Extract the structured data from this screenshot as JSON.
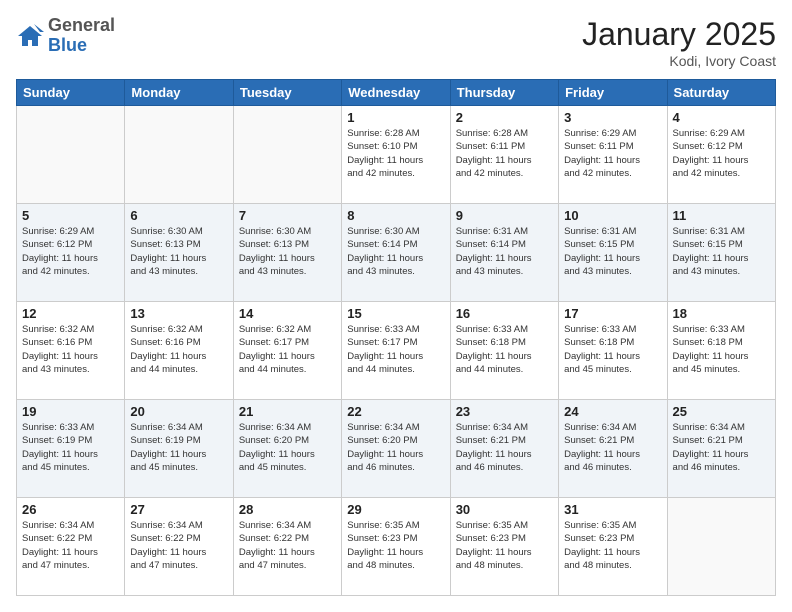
{
  "header": {
    "logo_general": "General",
    "logo_blue": "Blue",
    "month": "January 2025",
    "location": "Kodi, Ivory Coast"
  },
  "days_of_week": [
    "Sunday",
    "Monday",
    "Tuesday",
    "Wednesday",
    "Thursday",
    "Friday",
    "Saturday"
  ],
  "weeks": [
    [
      {
        "day": "",
        "info": ""
      },
      {
        "day": "",
        "info": ""
      },
      {
        "day": "",
        "info": ""
      },
      {
        "day": "1",
        "info": "Sunrise: 6:28 AM\nSunset: 6:10 PM\nDaylight: 11 hours\nand 42 minutes."
      },
      {
        "day": "2",
        "info": "Sunrise: 6:28 AM\nSunset: 6:11 PM\nDaylight: 11 hours\nand 42 minutes."
      },
      {
        "day": "3",
        "info": "Sunrise: 6:29 AM\nSunset: 6:11 PM\nDaylight: 11 hours\nand 42 minutes."
      },
      {
        "day": "4",
        "info": "Sunrise: 6:29 AM\nSunset: 6:12 PM\nDaylight: 11 hours\nand 42 minutes."
      }
    ],
    [
      {
        "day": "5",
        "info": "Sunrise: 6:29 AM\nSunset: 6:12 PM\nDaylight: 11 hours\nand 42 minutes."
      },
      {
        "day": "6",
        "info": "Sunrise: 6:30 AM\nSunset: 6:13 PM\nDaylight: 11 hours\nand 43 minutes."
      },
      {
        "day": "7",
        "info": "Sunrise: 6:30 AM\nSunset: 6:13 PM\nDaylight: 11 hours\nand 43 minutes."
      },
      {
        "day": "8",
        "info": "Sunrise: 6:30 AM\nSunset: 6:14 PM\nDaylight: 11 hours\nand 43 minutes."
      },
      {
        "day": "9",
        "info": "Sunrise: 6:31 AM\nSunset: 6:14 PM\nDaylight: 11 hours\nand 43 minutes."
      },
      {
        "day": "10",
        "info": "Sunrise: 6:31 AM\nSunset: 6:15 PM\nDaylight: 11 hours\nand 43 minutes."
      },
      {
        "day": "11",
        "info": "Sunrise: 6:31 AM\nSunset: 6:15 PM\nDaylight: 11 hours\nand 43 minutes."
      }
    ],
    [
      {
        "day": "12",
        "info": "Sunrise: 6:32 AM\nSunset: 6:16 PM\nDaylight: 11 hours\nand 43 minutes."
      },
      {
        "day": "13",
        "info": "Sunrise: 6:32 AM\nSunset: 6:16 PM\nDaylight: 11 hours\nand 44 minutes."
      },
      {
        "day": "14",
        "info": "Sunrise: 6:32 AM\nSunset: 6:17 PM\nDaylight: 11 hours\nand 44 minutes."
      },
      {
        "day": "15",
        "info": "Sunrise: 6:33 AM\nSunset: 6:17 PM\nDaylight: 11 hours\nand 44 minutes."
      },
      {
        "day": "16",
        "info": "Sunrise: 6:33 AM\nSunset: 6:18 PM\nDaylight: 11 hours\nand 44 minutes."
      },
      {
        "day": "17",
        "info": "Sunrise: 6:33 AM\nSunset: 6:18 PM\nDaylight: 11 hours\nand 45 minutes."
      },
      {
        "day": "18",
        "info": "Sunrise: 6:33 AM\nSunset: 6:18 PM\nDaylight: 11 hours\nand 45 minutes."
      }
    ],
    [
      {
        "day": "19",
        "info": "Sunrise: 6:33 AM\nSunset: 6:19 PM\nDaylight: 11 hours\nand 45 minutes."
      },
      {
        "day": "20",
        "info": "Sunrise: 6:34 AM\nSunset: 6:19 PM\nDaylight: 11 hours\nand 45 minutes."
      },
      {
        "day": "21",
        "info": "Sunrise: 6:34 AM\nSunset: 6:20 PM\nDaylight: 11 hours\nand 45 minutes."
      },
      {
        "day": "22",
        "info": "Sunrise: 6:34 AM\nSunset: 6:20 PM\nDaylight: 11 hours\nand 46 minutes."
      },
      {
        "day": "23",
        "info": "Sunrise: 6:34 AM\nSunset: 6:21 PM\nDaylight: 11 hours\nand 46 minutes."
      },
      {
        "day": "24",
        "info": "Sunrise: 6:34 AM\nSunset: 6:21 PM\nDaylight: 11 hours\nand 46 minutes."
      },
      {
        "day": "25",
        "info": "Sunrise: 6:34 AM\nSunset: 6:21 PM\nDaylight: 11 hours\nand 46 minutes."
      }
    ],
    [
      {
        "day": "26",
        "info": "Sunrise: 6:34 AM\nSunset: 6:22 PM\nDaylight: 11 hours\nand 47 minutes."
      },
      {
        "day": "27",
        "info": "Sunrise: 6:34 AM\nSunset: 6:22 PM\nDaylight: 11 hours\nand 47 minutes."
      },
      {
        "day": "28",
        "info": "Sunrise: 6:34 AM\nSunset: 6:22 PM\nDaylight: 11 hours\nand 47 minutes."
      },
      {
        "day": "29",
        "info": "Sunrise: 6:35 AM\nSunset: 6:23 PM\nDaylight: 11 hours\nand 48 minutes."
      },
      {
        "day": "30",
        "info": "Sunrise: 6:35 AM\nSunset: 6:23 PM\nDaylight: 11 hours\nand 48 minutes."
      },
      {
        "day": "31",
        "info": "Sunrise: 6:35 AM\nSunset: 6:23 PM\nDaylight: 11 hours\nand 48 minutes."
      },
      {
        "day": "",
        "info": ""
      }
    ]
  ]
}
